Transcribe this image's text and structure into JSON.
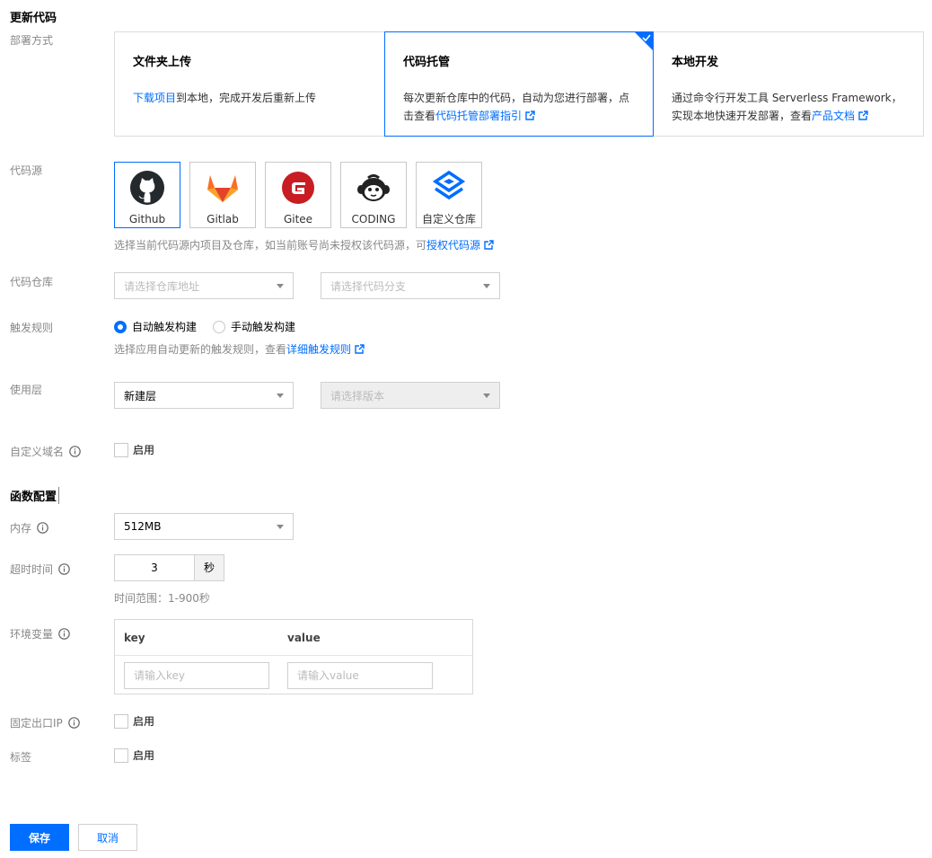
{
  "page_title": "更新代码",
  "deploy": {
    "label": "部署方式",
    "cards": [
      {
        "title": "文件夹上传",
        "desc_link": "下载项目",
        "desc_rest": "到本地，完成开发后重新上传"
      },
      {
        "title": "代码托管",
        "desc_prefix": "每次更新仓库中的代码，自动为您进行部署，点击查看",
        "desc_link": "代码托管部署指引",
        "selected": true
      },
      {
        "title": "本地开发",
        "desc_prefix": "通过命令行开发工具 Serverless Framework，实现本地快速开发部署，查看",
        "desc_link": "产品文档"
      }
    ]
  },
  "source": {
    "label": "代码源",
    "tiles": [
      {
        "name": "Github",
        "icon": "github-icon",
        "selected": true
      },
      {
        "name": "Gitlab",
        "icon": "gitlab-icon"
      },
      {
        "name": "Gitee",
        "icon": "gitee-icon"
      },
      {
        "name": "CODING",
        "icon": "coding-icon"
      },
      {
        "name": "自定义仓库",
        "icon": "custom-repo-icon"
      }
    ],
    "hint_prefix": "选择当前代码源内项目及仓库，如当前账号尚未授权该代码源，可",
    "hint_link": "授权代码源"
  },
  "repo": {
    "label": "代码仓库",
    "address_placeholder": "请选择仓库地址",
    "branch_placeholder": "请选择代码分支"
  },
  "trigger": {
    "label": "触发规则",
    "options": [
      "自动触发构建",
      "手动触发构建"
    ],
    "selected_index": 0,
    "hint_prefix": "选择应用自动更新的触发规则，查看",
    "hint_link": "详细触发规则"
  },
  "layer": {
    "label": "使用层",
    "value": "新建层",
    "version_placeholder": "请选择版本"
  },
  "custom_domain": {
    "label": "自定义域名",
    "checkbox_label": "启用"
  },
  "function_config": {
    "title": "函数配置"
  },
  "memory": {
    "label": "内存",
    "value": "512MB"
  },
  "timeout": {
    "label": "超时时间",
    "value": "3",
    "unit": "秒",
    "hint": "时间范围：1-900秒"
  },
  "env": {
    "label": "环境变量",
    "key_header": "key",
    "value_header": "value",
    "key_placeholder": "请输入key",
    "value_placeholder": "请输入value"
  },
  "fixed_ip": {
    "label": "固定出口IP",
    "checkbox_label": "启用"
  },
  "tags": {
    "label": "标签",
    "checkbox_label": "启用"
  },
  "actions": {
    "save": "保存",
    "cancel": "取消"
  },
  "colors": {
    "accent": "#006eff"
  }
}
